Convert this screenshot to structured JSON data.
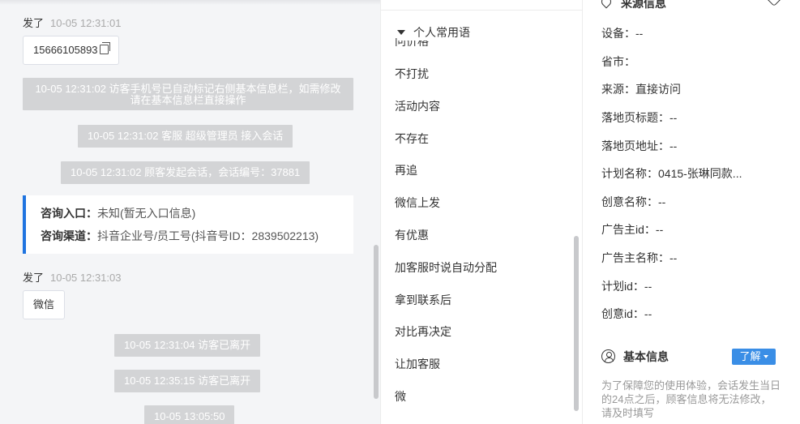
{
  "chat": {
    "msg1": {
      "sender": "发了",
      "time": "10-05 12:31:01",
      "content": "15666105893"
    },
    "sys1": "10-05 12:31:02 访客手机号已自动标记右侧基本信息栏，如需修改请在基本信息栏直接操作",
    "sys2": "10-05 12:31:02 客服 超级管理员 接入会话",
    "sys3": "10-05 12:31:02 顾客发起会话，会话编号：37881",
    "card": {
      "entry_label": "咨询入口：",
      "entry_value": "未知(暂无入口信息)",
      "channel_label": "咨询渠道：",
      "channel_value": "抖音企业号/员工号(抖音号ID：2839502213)"
    },
    "msg2": {
      "sender": "发了",
      "time": "10-05 12:31:03",
      "content": "微信"
    },
    "sys4": "10-05 12:31:04 访客已离开",
    "sys5": "10-05 12:35:15 访客已离开",
    "sys6": "10-05 13:05:50"
  },
  "phrases": {
    "header": "个人常用语",
    "clipped_item": "问价格",
    "items": [
      "不打扰",
      "活动内容",
      "不存在",
      "再追",
      "微信上发",
      "有优惠",
      "加客服时说自动分配",
      "拿到联系后",
      "对比再决定",
      "让加客服",
      "微"
    ]
  },
  "info": {
    "source_title": "来源信息",
    "fields": [
      {
        "label": "设备：",
        "value": "--"
      },
      {
        "label": "省市：",
        "value": ""
      },
      {
        "label": "来源：",
        "value": "直接访问"
      },
      {
        "label": "落地页标题：",
        "value": "--"
      },
      {
        "label": "落地页地址：",
        "value": "--"
      },
      {
        "label": "计划名称：",
        "value": "0415-张琳同款..."
      },
      {
        "label": "创意名称：",
        "value": "--"
      },
      {
        "label": "广告主id：",
        "value": "--"
      },
      {
        "label": "广告主名称：",
        "value": "--"
      },
      {
        "label": "计划id：",
        "value": "--"
      },
      {
        "label": "创意id：",
        "value": "--"
      }
    ],
    "basic_title": "基本信息",
    "learn_label": "了解",
    "notice": "为了保障您的使用体验，会话发生当日的24点之后，顾客信息将无法修改，请及时填写"
  },
  "colors": {
    "accent": "#1f74e0",
    "button": "#3a8ee6",
    "system_bubble": "#d3d4d6",
    "chat_bg": "#f4f5f7"
  }
}
